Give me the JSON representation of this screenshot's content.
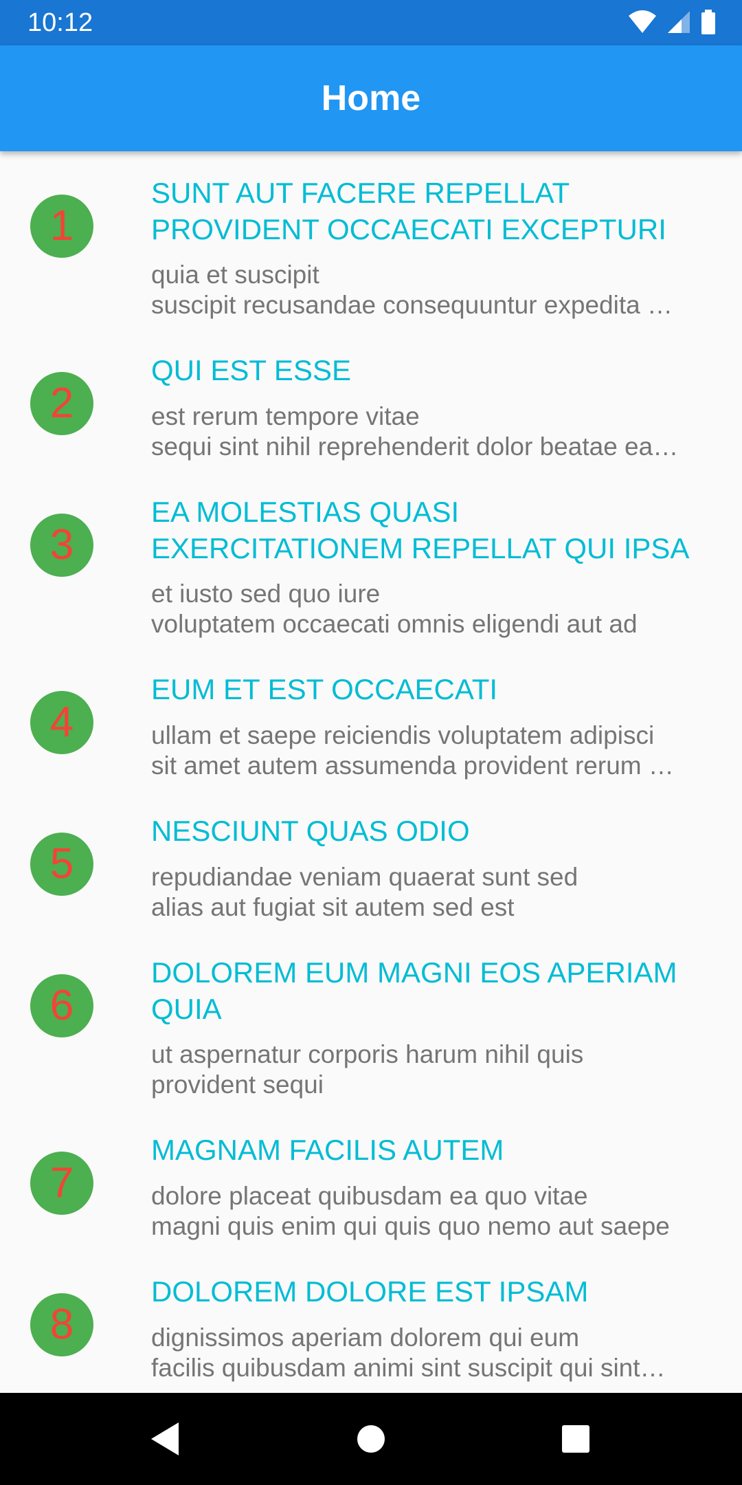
{
  "status_bar": {
    "time": "10:12",
    "icons": [
      "wifi-icon",
      "cell-signal-icon",
      "battery-icon"
    ],
    "color": "#1976d2"
  },
  "app_bar": {
    "title": "Home",
    "color": "#2196f3"
  },
  "colors": {
    "avatar_background": "#4caf50",
    "avatar_number": "#f44336",
    "title_text": "#00bcd4",
    "body_text": "#757575"
  },
  "posts": [
    {
      "number": "1",
      "title_lines": [
        "SUNT AUT FACERE REPELLAT",
        "PROVIDENT OCCAECATI EXCEPTURI"
      ],
      "body_lines": [
        "quia et suscipit",
        "suscipit recusandae consequuntur expedita …"
      ]
    },
    {
      "number": "2",
      "title_lines": [
        "QUI EST ESSE"
      ],
      "body_lines": [
        "est rerum tempore vitae",
        "sequi sint nihil reprehenderit dolor beatae ea…"
      ]
    },
    {
      "number": "3",
      "title_lines": [
        "EA MOLESTIAS QUASI",
        "EXERCITATIONEM REPELLAT QUI IPSA"
      ],
      "body_lines": [
        "et iusto sed quo iure",
        "voluptatem occaecati omnis eligendi aut ad"
      ]
    },
    {
      "number": "4",
      "title_lines": [
        "EUM ET EST OCCAECATI"
      ],
      "body_lines": [
        "ullam et saepe reiciendis voluptatem adipisci",
        "sit amet autem assumenda provident rerum …"
      ]
    },
    {
      "number": "5",
      "title_lines": [
        "NESCIUNT QUAS ODIO"
      ],
      "body_lines": [
        "repudiandae veniam quaerat sunt sed",
        "alias aut fugiat sit autem sed est"
      ]
    },
    {
      "number": "6",
      "title_lines": [
        "DOLOREM EUM MAGNI EOS APERIAM",
        "QUIA"
      ],
      "body_lines": [
        "ut aspernatur corporis harum nihil quis",
        "provident sequi"
      ]
    },
    {
      "number": "7",
      "title_lines": [
        "MAGNAM FACILIS AUTEM"
      ],
      "body_lines": [
        "dolore placeat quibusdam ea quo vitae",
        "magni quis enim qui quis quo nemo aut saepe"
      ]
    },
    {
      "number": "8",
      "title_lines": [
        "DOLOREM DOLORE EST IPSAM"
      ],
      "body_lines": [
        "dignissimos aperiam dolorem qui eum",
        "facilis quibusdam animi sint suscipit qui sint…"
      ]
    }
  ],
  "nav_bar": {
    "buttons": [
      "back-icon",
      "home-icon",
      "recents-icon"
    ]
  }
}
